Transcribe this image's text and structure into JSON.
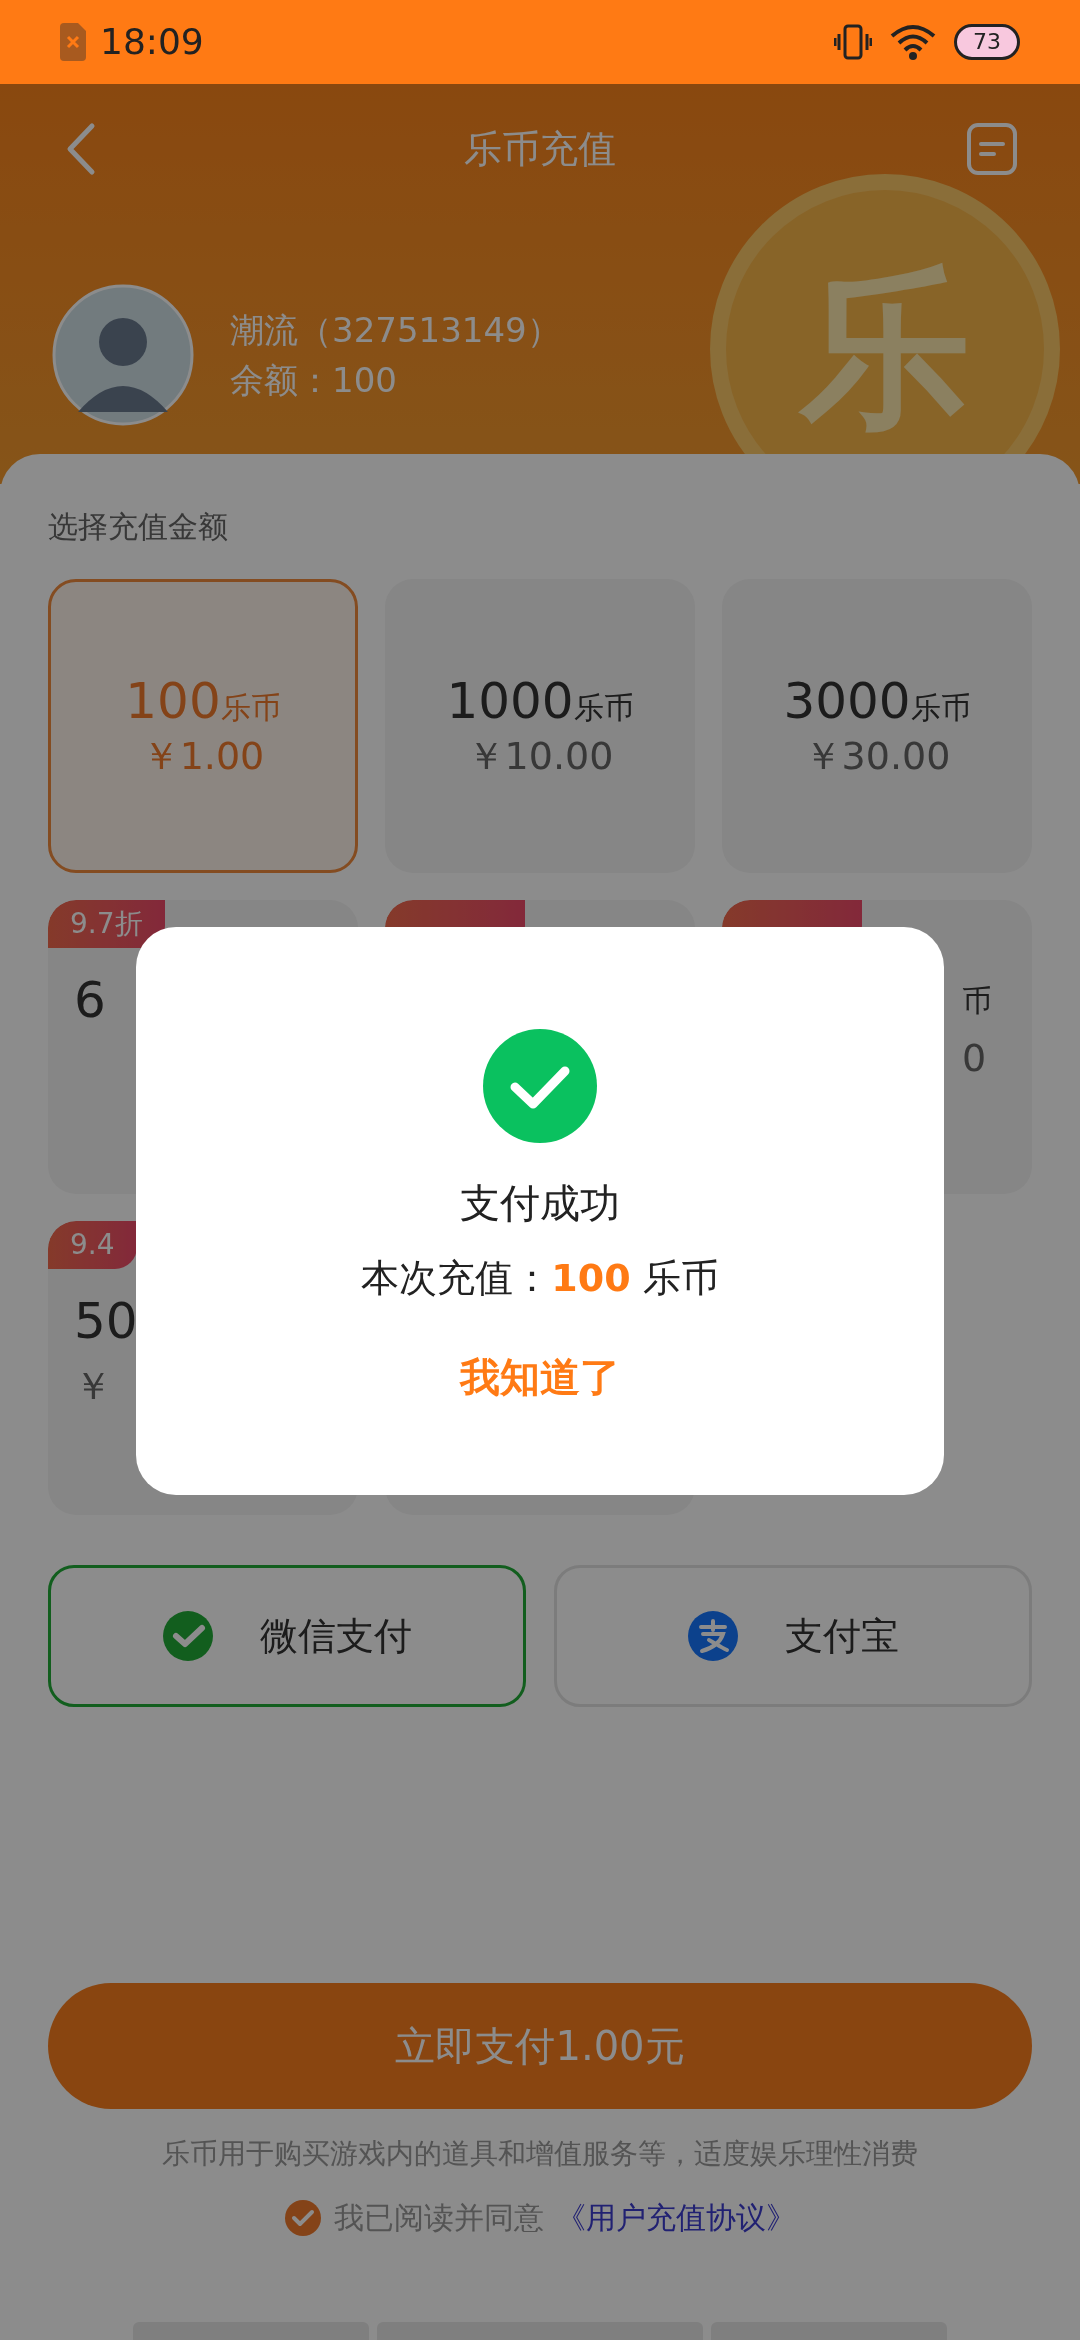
{
  "status_bar": {
    "time": "18:09",
    "battery": "73"
  },
  "header": {
    "title": "乐币充值",
    "coin_glyph": "乐"
  },
  "user": {
    "name": "潮流（327513149）",
    "balance": "余额：100"
  },
  "section_title": "选择充值金额",
  "packages": [
    {
      "amount": "100",
      "unit": "乐币",
      "price": "￥1.00",
      "selected": true
    },
    {
      "amount": "1000",
      "unit": "乐币",
      "price": "￥10.00",
      "selected": false
    },
    {
      "amount": "3000",
      "unit": "乐币",
      "price": "￥30.00",
      "selected": false
    },
    {
      "badge": "9.7折",
      "amount": "6",
      "selected": false
    },
    {
      "discounted": true,
      "selected": false
    },
    {
      "discounted": true,
      "unit": "币",
      "price": "0",
      "selected": false
    },
    {
      "badge": "9.4",
      "amount": "50",
      "price": "￥",
      "selected": false
    },
    {
      "selected": false
    }
  ],
  "payments": [
    {
      "label": "微信支付",
      "kind": "wechat",
      "selected": true
    },
    {
      "label": "支付宝",
      "kind": "alipay",
      "selected": false
    }
  ],
  "pay_button": "立即支付1.00元",
  "note": "乐币用于购买游戏内的道具和增值服务等，适度娱乐理性消费",
  "agreement": {
    "checked": true,
    "text": "我已阅读并同意",
    "link": "《用户充值协议》"
  },
  "dialog": {
    "title": "支付成功",
    "message": "本次充值：**100** 乐币",
    "button": "我知道了"
  }
}
